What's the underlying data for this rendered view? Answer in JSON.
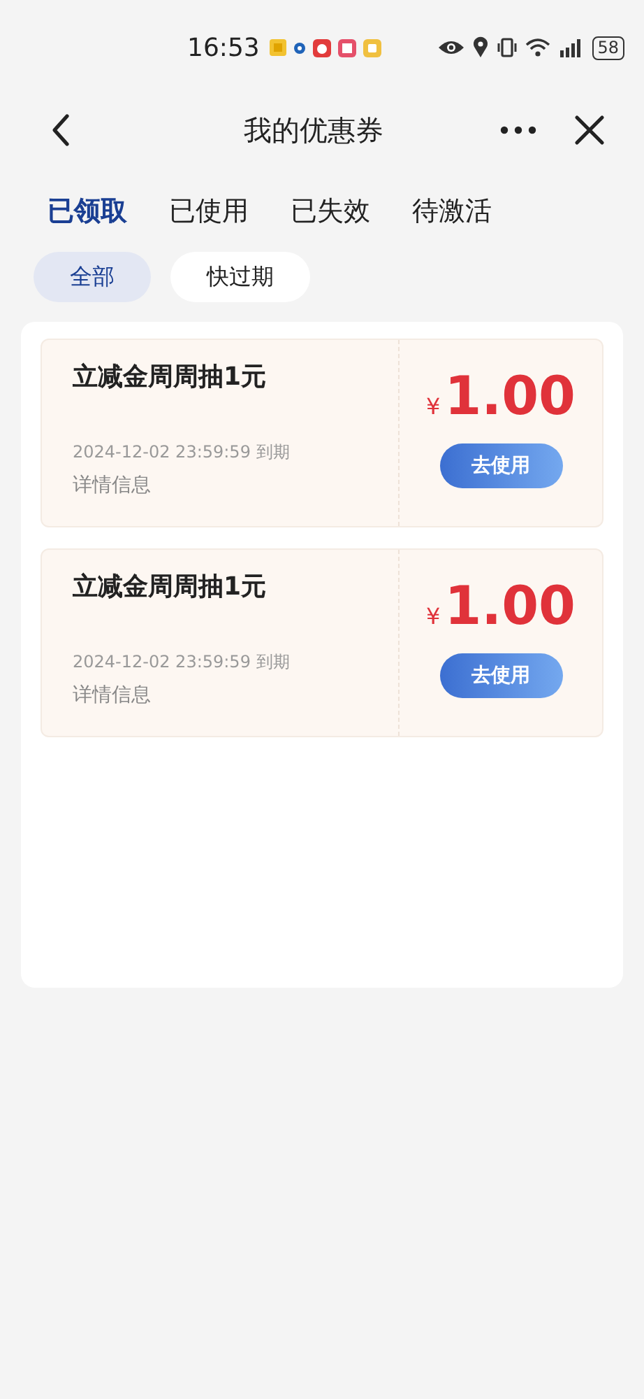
{
  "status_bar": {
    "time": "16:53",
    "battery": "58"
  },
  "nav": {
    "title": "我的优惠券"
  },
  "tabs": [
    {
      "label": "已领取",
      "selected": true
    },
    {
      "label": "已使用",
      "selected": false
    },
    {
      "label": "已失效",
      "selected": false
    },
    {
      "label": "待激活",
      "selected": false
    }
  ],
  "filters": [
    {
      "label": "全部",
      "selected": true
    },
    {
      "label": "快过期",
      "selected": false
    }
  ],
  "coupons": [
    {
      "title": "立减金周周抽1元",
      "expiry": "2024-12-02 23:59:59 到期",
      "details": "详情信息",
      "currency": "¥",
      "amount": "1.00",
      "action": "去使用"
    },
    {
      "title": "立减金周周抽1元",
      "expiry": "2024-12-02 23:59:59 到期",
      "details": "详情信息",
      "currency": "¥",
      "amount": "1.00",
      "action": "去使用"
    }
  ]
}
